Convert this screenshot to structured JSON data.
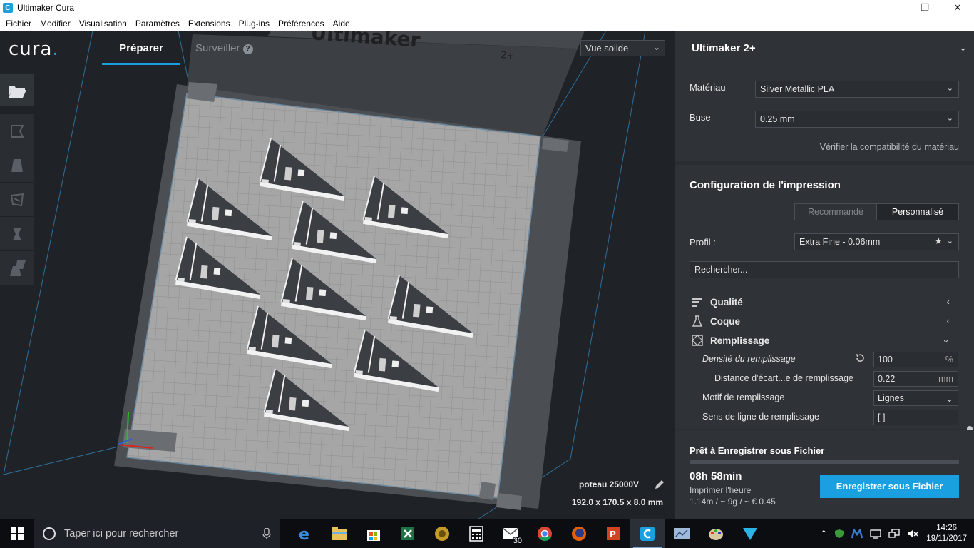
{
  "window": {
    "title": "Ultimaker Cura",
    "app_icon": "C",
    "minimize": "—",
    "maximize": "❐",
    "close": "✕"
  },
  "menu": [
    "Fichier",
    "Modifier",
    "Visualisation",
    "Paramètres",
    "Extensions",
    "Plug-ins",
    "Préférences",
    "Aide"
  ],
  "header": {
    "logo": "cura",
    "logo_dot": ".",
    "tab_prepare": "Préparer",
    "tab_monitor": "Surveiller",
    "help_glyph": "?",
    "view_mode": "Vue solide"
  },
  "viewport": {
    "plate_label": "Ultimaker",
    "plate_sup": "2+",
    "model_name": "poteau 25000V",
    "model_dims": "192.0 x 170.5 x 8.0 mm"
  },
  "printer": {
    "name": "Ultimaker 2+",
    "material_label": "Matériau",
    "material_value": "Silver Metallic PLA",
    "nozzle_label": "Buse",
    "nozzle_value": "0.25 mm",
    "verify_link": "Vérifier la compatibilité du matériau"
  },
  "config": {
    "title": "Configuration de l'impression",
    "mode_recommended": "Recommandé",
    "mode_custom": "Personnalisé",
    "profile_label": "Profil :",
    "profile_value": "Extra Fine - 0.06mm",
    "search_placeholder": "Rechercher...",
    "categories": {
      "quality": "Qualité",
      "shell": "Coque",
      "infill": "Remplissage"
    },
    "settings": {
      "density_label": "Densité du remplissage",
      "density_value": "100",
      "density_unit": "%",
      "distance_label": "Distance d'écart...e de remplissage",
      "distance_value": "0.22",
      "distance_unit": "mm",
      "pattern_label": "Motif de remplissage",
      "pattern_value": "Lignes",
      "direction_label": "Sens de ligne de remplissage",
      "direction_value": "[ ]"
    }
  },
  "ready": {
    "title": "Prêt à Enregistrer sous Fichier",
    "time": "08h 58min",
    "subtitle": "Imprimer l'heure",
    "usage": "1.14m / ~ 9g / ~ € 0.45",
    "save_button": "Enregistrer sous Fichier"
  },
  "taskbar": {
    "search_placeholder": "Taper ici pour rechercher",
    "mail_badge": "30",
    "time": "14:26",
    "date": "19/11/2017"
  },
  "colors": {
    "accent": "#1a9fe0",
    "panel": "#2f3337",
    "background": "#1f2327",
    "plate": "#a9a9a9"
  }
}
